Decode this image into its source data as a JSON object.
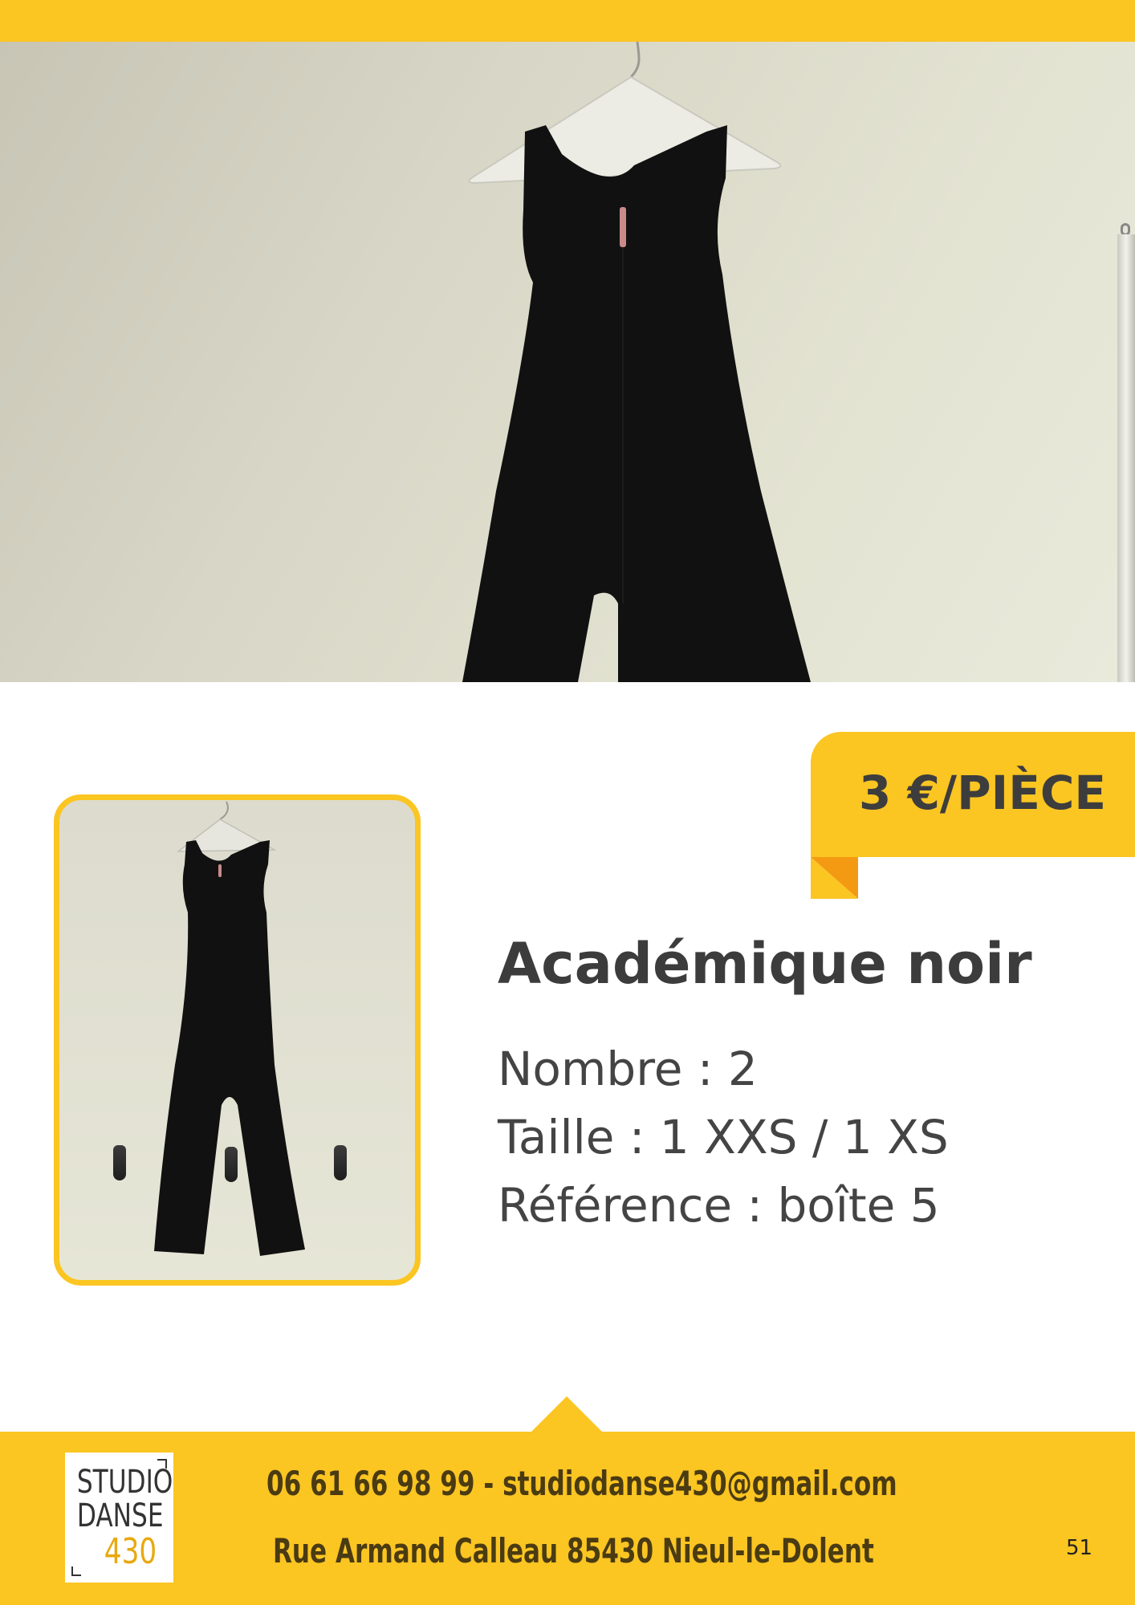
{
  "product": {
    "price": "3 €/PIÈCE",
    "title": "Académique noir",
    "details": {
      "quantity": "Nombre : 2",
      "size": "Taille : 1 XXS / 1 XS",
      "reference": "Référence : boîte 5"
    }
  },
  "footer": {
    "logo": {
      "line1": "STUDIO",
      "line2": "DANSE",
      "line3": "430"
    },
    "contact": "06 61 66 98 99 - studiodanse430@gmail.com",
    "address": "Rue Armand Calleau 85430 Nieul-le-Dolent",
    "page_number": "51"
  },
  "colors": {
    "accent_yellow": "#FBC522",
    "accent_orange": "#F39A12",
    "text_dark": "#3c3c3c"
  }
}
